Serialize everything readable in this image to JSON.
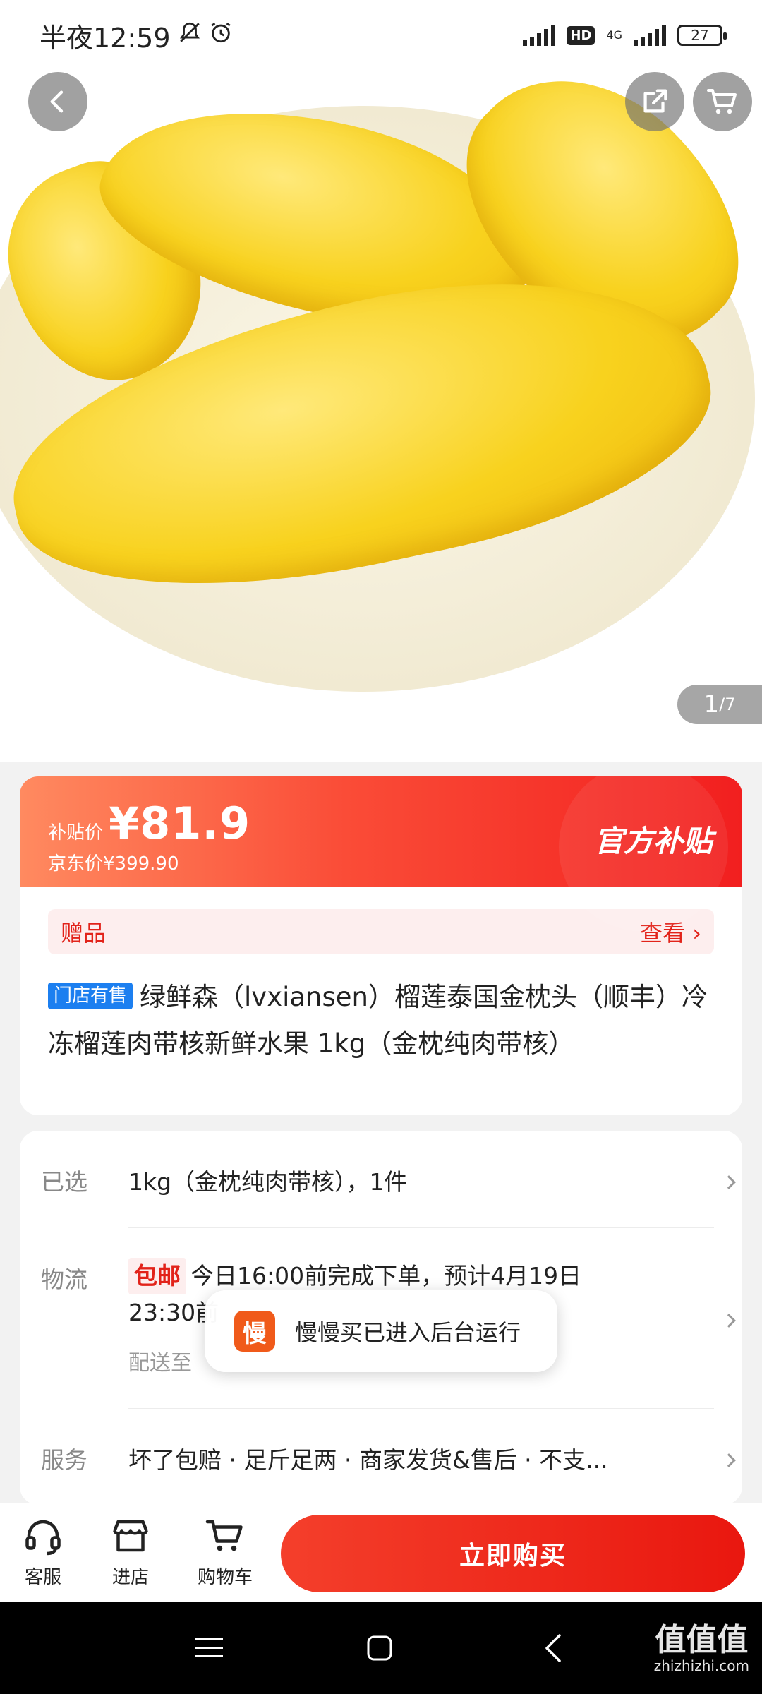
{
  "status_bar": {
    "time": "半夜12:59",
    "hd_label": "HD",
    "network": "4G",
    "battery": "27"
  },
  "hero": {
    "page_current": "1",
    "page_total": "/7"
  },
  "price": {
    "subsidy_label": "补贴价",
    "subsidy_value": "¥81.9",
    "jd_price": "京东价¥399.90",
    "official_tag": "官方补贴"
  },
  "gift": {
    "label": "赠品",
    "link": "查看"
  },
  "product": {
    "store_badge": "门店有售",
    "title": "绿鲜森（lvxiansen）榴莲泰国金枕头（顺丰）冷冻榴莲肉带核新鲜水果 1kg（金枕纯肉带核）"
  },
  "info": {
    "selected_label": "已选",
    "selected_value": "1kg（金枕纯肉带核），1件",
    "logistics_label": "物流",
    "free_shipping": "包邮",
    "logistics_line1": "今日16:00前完成下单，预计4月19日",
    "logistics_line2": "23:30前",
    "delivery_label": "配送至",
    "service_label": "服务",
    "service_value": "坏了包赔 · 足斤足两 · 商家发货&售后 · 不支..."
  },
  "toast": {
    "icon_char": "慢",
    "text": "慢慢买已进入后台运行"
  },
  "bottom_bar": {
    "service": "客服",
    "store": "进店",
    "cart": "购物车",
    "buy_now": "立即购买"
  },
  "watermark": {
    "main": "值值值",
    "sub": "zhizhizhi.com"
  },
  "colors": {
    "accent_red": "#e2231a",
    "badge_blue": "#1c7ff0",
    "toast_orange": "#f05a1a"
  }
}
